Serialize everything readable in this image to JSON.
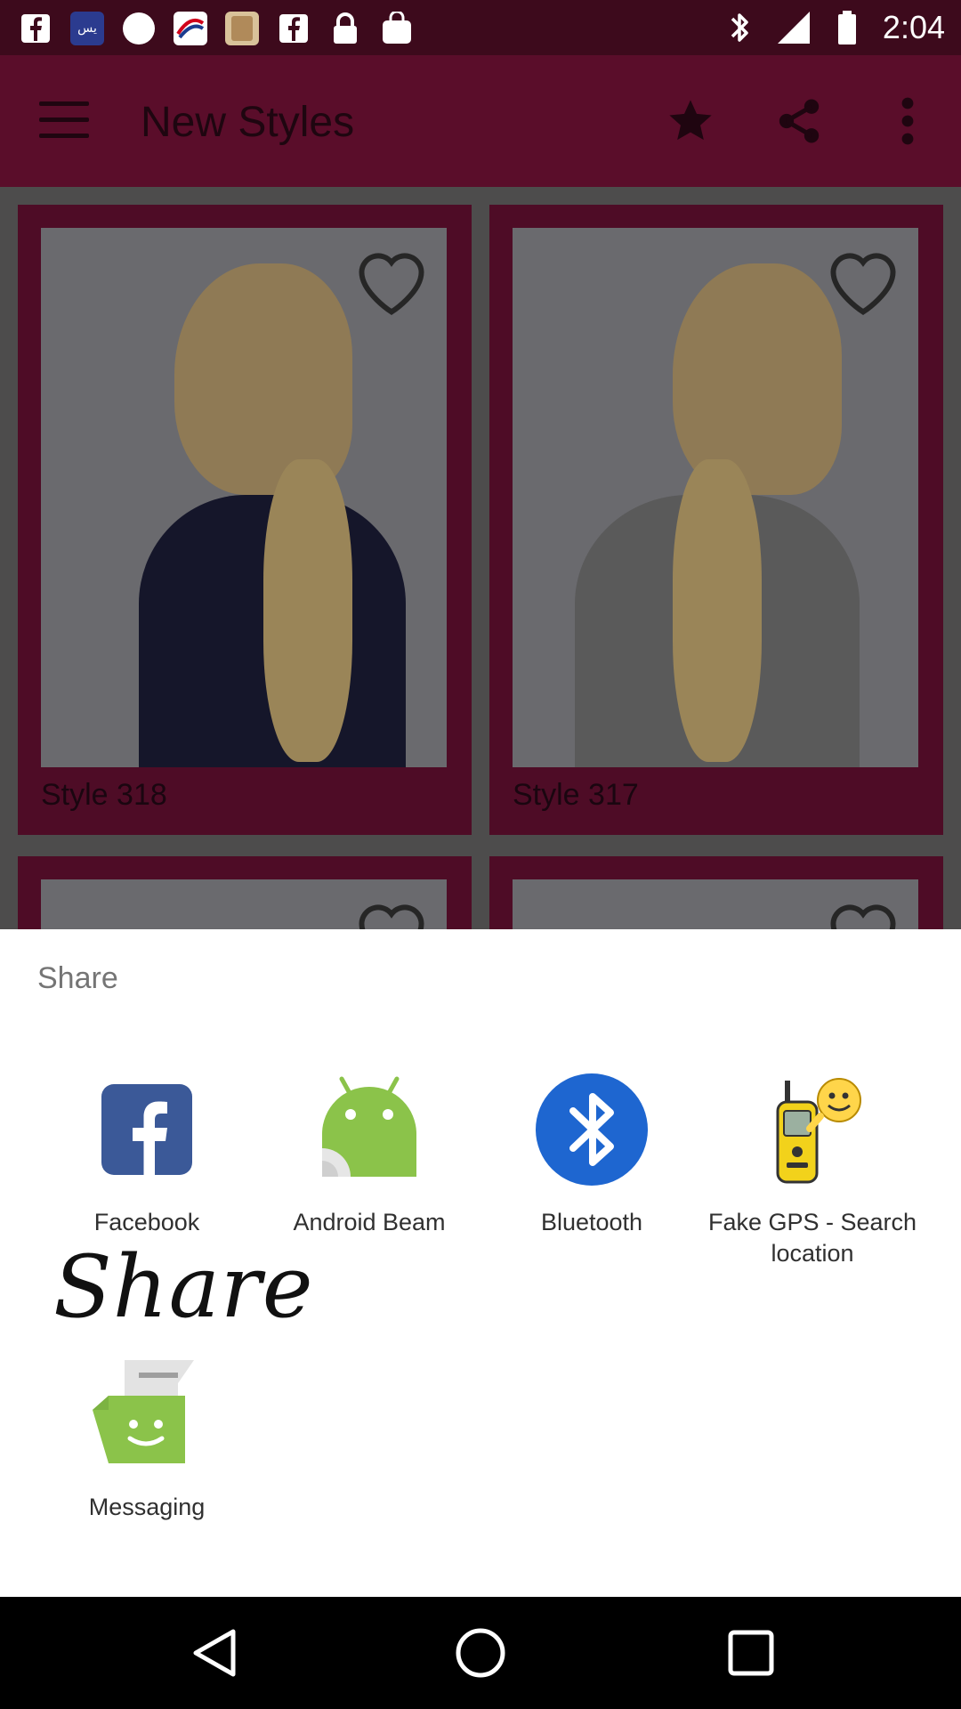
{
  "status_bar": {
    "time": "2:04",
    "notification_icons": [
      "facebook-icon",
      "sarah-yaski-app-icon",
      "circle-icon",
      "airline-app-icon",
      "photo-app-icon",
      "facebook-icon",
      "lock-icon",
      "bag-icon"
    ],
    "system_icons": [
      "bluetooth-icon",
      "signal-icon",
      "battery-icon"
    ]
  },
  "app_bar": {
    "title": "New Styles",
    "icons": [
      "menu-icon",
      "star-icon",
      "share-icon",
      "more-vert-icon"
    ]
  },
  "grid": {
    "cards": [
      {
        "label": "Style 318"
      },
      {
        "label": "Style 317"
      }
    ]
  },
  "share_sheet": {
    "title": "Share",
    "apps": [
      {
        "label": "Facebook",
        "icon": "facebook-icon"
      },
      {
        "label": "Android Beam",
        "icon": "android-beam-icon"
      },
      {
        "label": "Bluetooth",
        "icon": "bluetooth-icon"
      },
      {
        "label": "Fake GPS - Search location",
        "icon": "fake-gps-icon"
      },
      {
        "label": "Messaging",
        "icon": "messaging-icon"
      }
    ]
  },
  "overlay_text": "Share",
  "nav_bar": {
    "buttons": [
      "back-icon",
      "home-icon",
      "recents-icon"
    ]
  },
  "colors": {
    "app_bar": "#5a0d2a",
    "status_bar": "#3d0a1c",
    "facebook_blue": "#3b5998",
    "android_green": "#8bc34a",
    "bluetooth_blue": "#1e66d0"
  }
}
